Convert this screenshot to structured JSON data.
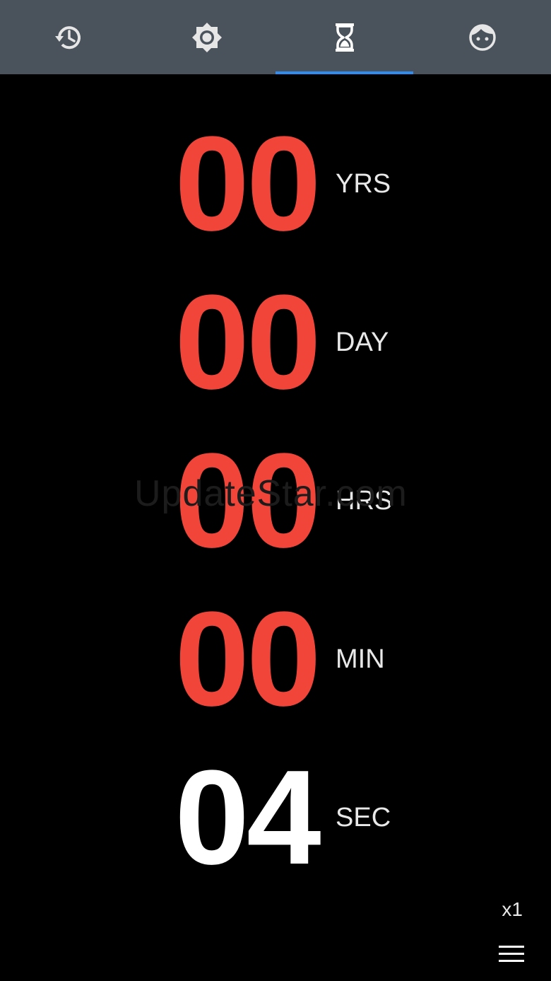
{
  "tabs": [
    {
      "icon": "history-icon",
      "active": false
    },
    {
      "icon": "brightness-icon",
      "active": false
    },
    {
      "icon": "hourglass-icon",
      "active": true
    },
    {
      "icon": "face-icon",
      "active": false
    }
  ],
  "colors": {
    "tabbar_bg": "#4a535c",
    "accent": "#2f8cf0",
    "digits": "#f2453a",
    "current_digits": "#ffffff",
    "background": "#000000"
  },
  "countdown": [
    {
      "value": "00",
      "unit": "YRS"
    },
    {
      "value": "00",
      "unit": "DAY"
    },
    {
      "value": "00",
      "unit": "HRS"
    },
    {
      "value": "00",
      "unit": "MIN"
    },
    {
      "value": "04",
      "unit": "SEC"
    }
  ],
  "watermark": "UpdateStar.com",
  "speed_label": "x1",
  "menu_icon": "hamburger-menu-icon"
}
